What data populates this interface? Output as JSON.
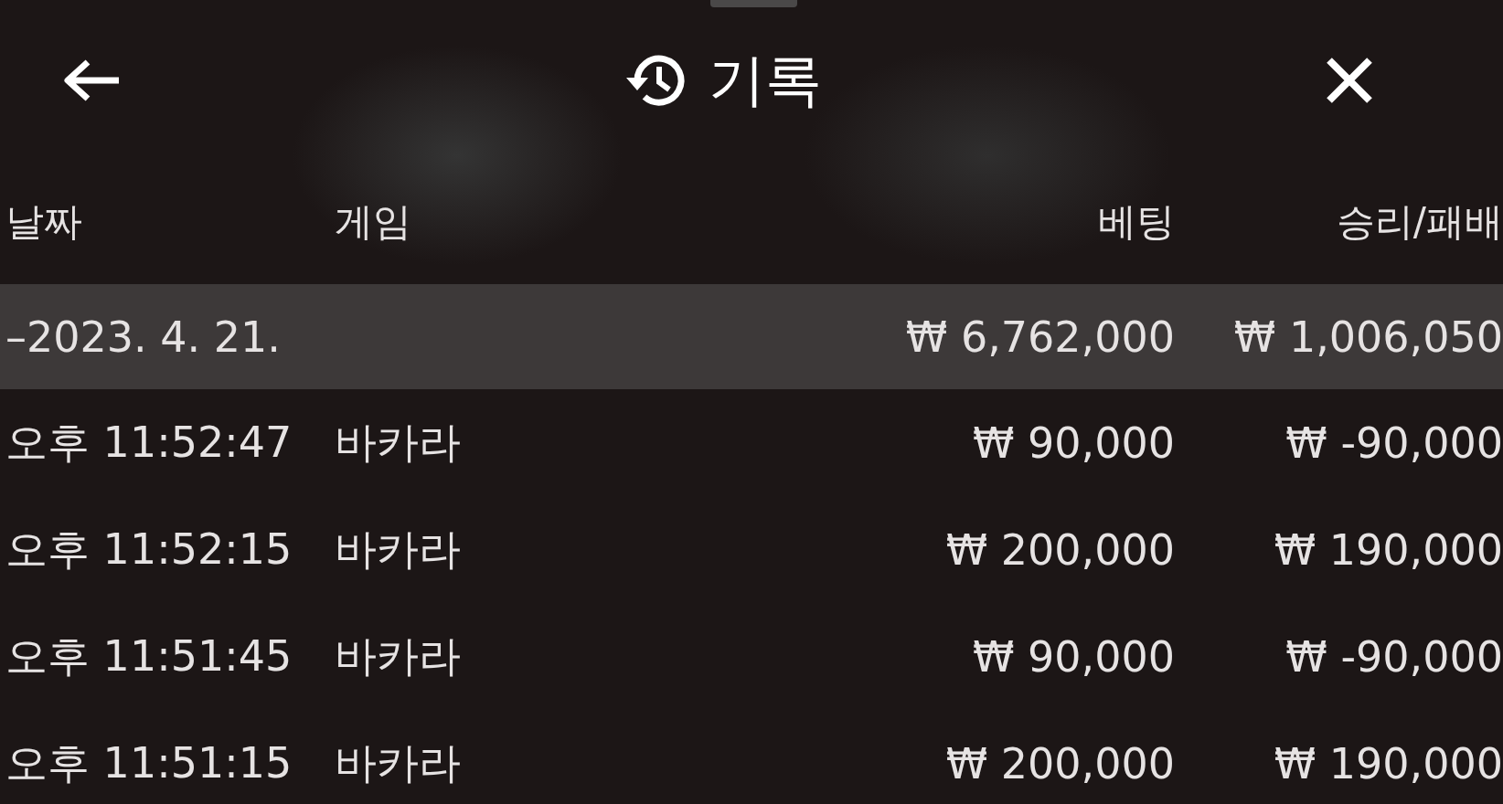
{
  "header": {
    "title": "기록"
  },
  "columns": [
    "날짜",
    "게임",
    "베팅",
    "승리/패배"
  ],
  "summary": {
    "date": "–2023. 4. 21.",
    "bet": "₩ 6,762,000",
    "result": "₩ 1,006,050"
  },
  "rows": [
    {
      "time": "오후 11:52:47",
      "game": "바카라",
      "bet": "₩ 90,000",
      "result": "₩ -90,000"
    },
    {
      "time": "오후 11:52:15",
      "game": "바카라",
      "bet": "₩ 200,000",
      "result": "₩ 190,000"
    },
    {
      "time": "오후 11:51:45",
      "game": "바카라",
      "bet": "₩ 90,000",
      "result": "₩ -90,000"
    },
    {
      "time": "오후 11:51:15",
      "game": "바카라",
      "bet": "₩ 200,000",
      "result": "₩ 190,000"
    }
  ]
}
